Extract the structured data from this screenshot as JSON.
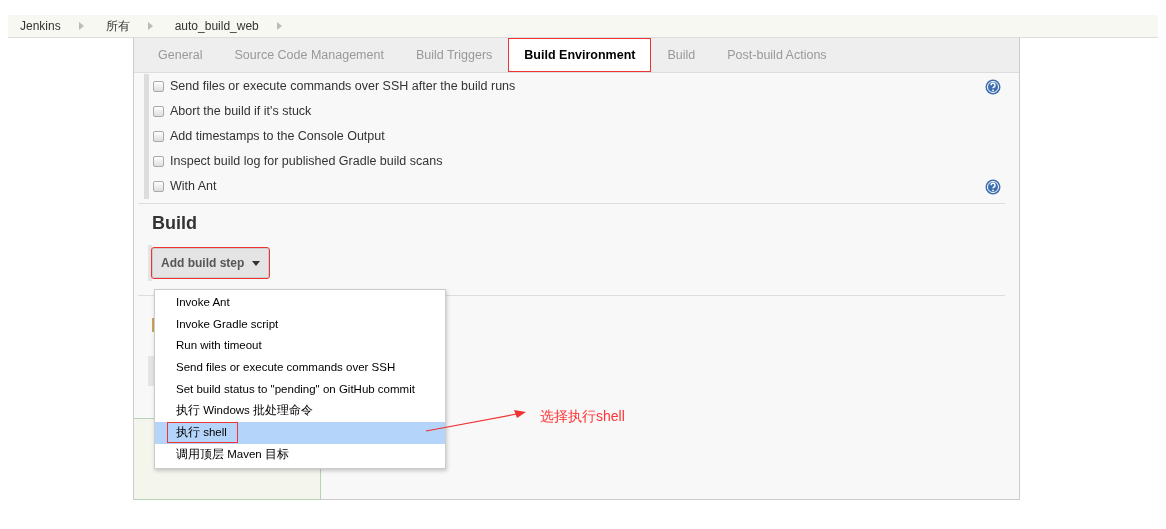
{
  "breadcrumbs": [
    {
      "label": "Jenkins"
    },
    {
      "label": "所有"
    },
    {
      "label": "auto_build_web"
    }
  ],
  "tabs": [
    {
      "label": "General",
      "selected": false,
      "annotated": false
    },
    {
      "label": "Source Code Management",
      "selected": false,
      "annotated": false
    },
    {
      "label": "Build Triggers",
      "selected": false,
      "annotated": false
    },
    {
      "label": "Build Environment",
      "selected": true,
      "annotated": true
    },
    {
      "label": "Build",
      "selected": false,
      "annotated": false
    },
    {
      "label": "Post-build Actions",
      "selected": false,
      "annotated": false
    }
  ],
  "build_environment": [
    {
      "label": "Send files or execute commands over SSH after the build runs",
      "checked": false,
      "help": true
    },
    {
      "label": "Abort the build if it's stuck",
      "checked": false,
      "help": false
    },
    {
      "label": "Add timestamps to the Console Output",
      "checked": false,
      "help": false
    },
    {
      "label": "Inspect build log for published Gradle build scans",
      "checked": false,
      "help": false
    },
    {
      "label": "With Ant",
      "checked": false,
      "help": true
    }
  ],
  "build": {
    "title": "Build",
    "add_button": {
      "label": "Add build step",
      "annotated": true
    },
    "menu": [
      {
        "label": "Invoke Ant",
        "selected": false,
        "annotated": false
      },
      {
        "label": "Invoke Gradle script",
        "selected": false,
        "annotated": false
      },
      {
        "label": "Run with timeout",
        "selected": false,
        "annotated": false
      },
      {
        "label": "Send files or execute commands over SSH",
        "selected": false,
        "annotated": false
      },
      {
        "label": "Set build status to \"pending\" on GitHub commit",
        "selected": false,
        "annotated": false
      },
      {
        "label": "执行 Windows 批处理命令",
        "selected": false,
        "annotated": false
      },
      {
        "label": "执行 shell",
        "selected": true,
        "annotated": true
      },
      {
        "label": "调用顶层 Maven 目标",
        "selected": false,
        "annotated": false
      }
    ]
  },
  "annotation": {
    "text": "选择执行shell"
  }
}
